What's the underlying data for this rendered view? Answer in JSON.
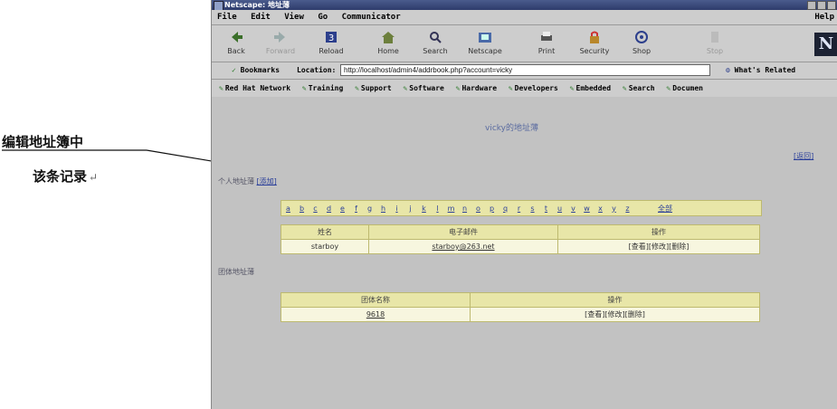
{
  "callout": {
    "line1": "编辑地址簿中",
    "line2": "该条记录",
    "return_mark": "↵"
  },
  "window": {
    "title": "Netscape: 地址薄"
  },
  "menu": [
    "File",
    "Edit",
    "View",
    "Go",
    "Communicator"
  ],
  "menu_help": "Help",
  "toolbar": {
    "buttons": [
      {
        "label": "Back",
        "icon": "back-arrow-icon"
      },
      {
        "label": "Forward",
        "icon": "forward-arrow-icon"
      },
      {
        "label": "Reload",
        "icon": "reload-icon"
      },
      {
        "label": "Home",
        "icon": "home-icon"
      },
      {
        "label": "Search",
        "icon": "search-icon"
      },
      {
        "label": "Netscape",
        "icon": "netscape-icon"
      },
      {
        "label": "Print",
        "icon": "print-icon"
      },
      {
        "label": "Security",
        "icon": "security-icon"
      },
      {
        "label": "Shop",
        "icon": "shop-icon"
      },
      {
        "label": "Stop",
        "icon": "stop-icon"
      }
    ],
    "logo": "N"
  },
  "location": {
    "bookmarks": "Bookmarks",
    "label": "Location:",
    "url": "http://localhost/admin4/addrbook.php?account=vicky",
    "related": "What's Related"
  },
  "personal_toolbar": [
    "Red Hat Network",
    "Training",
    "Support",
    "Software",
    "Hardware",
    "Developers",
    "Embedded",
    "Search",
    "Documen"
  ],
  "page": {
    "title": "vicky的地址薄",
    "back_link": "[返回]",
    "personal_section": "个人地址薄",
    "personal_add": "[添加]",
    "letters": [
      "a",
      "b",
      "c",
      "d",
      "e",
      "f",
      "g",
      "h",
      "i",
      "j",
      "k",
      "l",
      "m",
      "n",
      "o",
      "p",
      "q",
      "r",
      "s",
      "t",
      "u",
      "v",
      "w",
      "x",
      "y",
      "z"
    ],
    "all_label": "全部",
    "personal_table": {
      "headers": [
        "姓名",
        "电子邮件",
        "操作"
      ],
      "rows": [
        {
          "name": "starboy",
          "email": "starboy@263.net",
          "actions": "[查看][修改][删除]"
        }
      ]
    },
    "group_section": "团体地址薄",
    "group_table": {
      "headers": [
        "团体名称",
        "操作"
      ],
      "rows": [
        {
          "name": "9618",
          "actions": "[查看][修改][删除]"
        }
      ]
    }
  }
}
